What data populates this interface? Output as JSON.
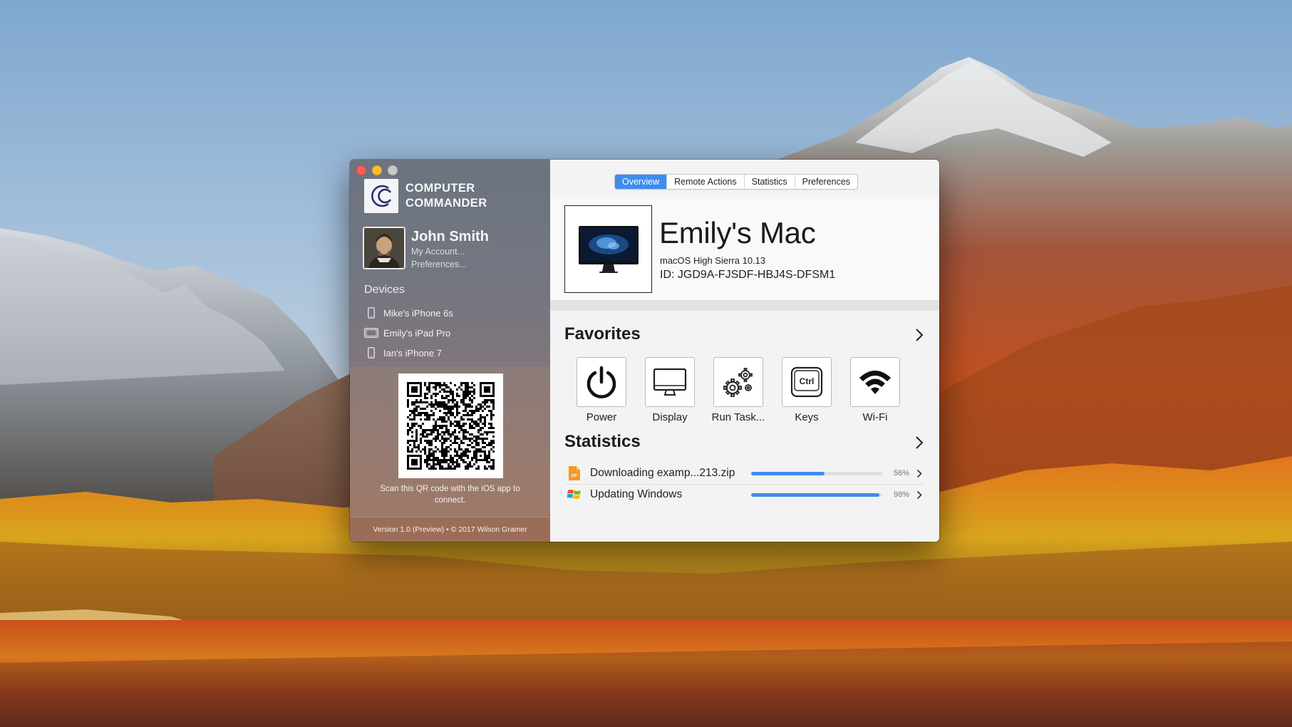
{
  "app": {
    "brand_line1": "COMPUTER",
    "brand_line2": "COMMANDER"
  },
  "user": {
    "name": "John Smith",
    "my_account": "My Account...",
    "preferences": "Preferences..."
  },
  "devices": {
    "title": "Devices",
    "items": [
      {
        "label": "Mike's iPhone 6s",
        "icon": "iphone-icon"
      },
      {
        "label": "Emily's iPad Pro",
        "icon": "ipad-icon"
      },
      {
        "label": "Ian's iPhone 7",
        "icon": "iphone-icon"
      }
    ]
  },
  "qr": {
    "caption": "Scan this QR code with the iOS app to connect."
  },
  "footer": {
    "version": "Version 1.0 (Preview) • © 2017 Wilson Gramer"
  },
  "tabs": [
    {
      "label": "Overview",
      "active": true
    },
    {
      "label": "Remote Actions",
      "active": false
    },
    {
      "label": "Statistics",
      "active": false
    },
    {
      "label": "Preferences",
      "active": false
    }
  ],
  "device": {
    "name": "Emily's Mac",
    "os": "macOS High Sierra 10.13",
    "id": "ID: JGD9A-FJSDF-HBJ4S-DFSM1"
  },
  "favorites": {
    "title": "Favorites",
    "items": [
      {
        "label": "Power",
        "icon": "power-icon"
      },
      {
        "label": "Display",
        "icon": "display-icon"
      },
      {
        "label": "Run Task...",
        "icon": "gears-icon"
      },
      {
        "label": "Keys",
        "icon": "ctrl-key-icon"
      },
      {
        "label": "Wi-Fi",
        "icon": "wifi-icon"
      }
    ]
  },
  "statistics": {
    "title": "Statistics",
    "items": [
      {
        "label": "Downloading examp...213.zip",
        "progress": 0.56,
        "percent_label": "56%",
        "icon": "zip-file-icon"
      },
      {
        "label": "Updating Windows",
        "progress": 0.98,
        "percent_label": "98%",
        "icon": "windows-logo-icon"
      }
    ]
  },
  "colors": {
    "accent": "#3d8cf0",
    "close": "#fc5f57",
    "minimize": "#fdbc2e",
    "maximize": "#c9c9c9"
  }
}
